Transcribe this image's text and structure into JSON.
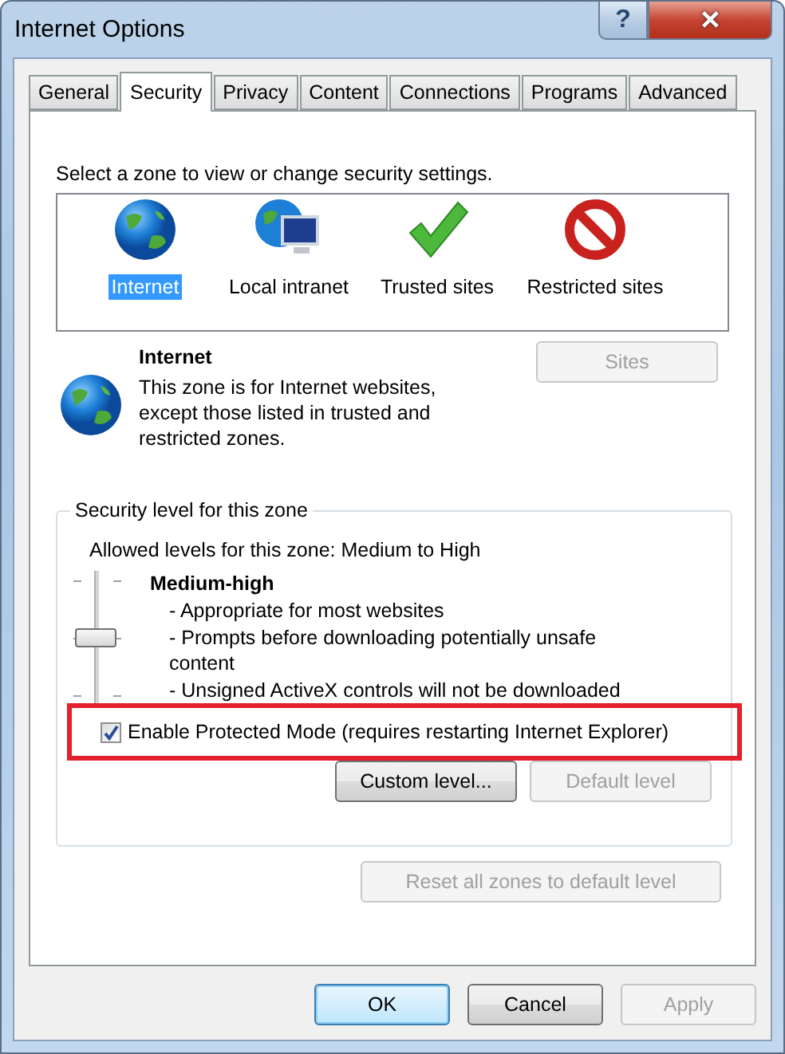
{
  "window": {
    "title": "Internet Options",
    "title_buttons": [
      "?",
      "✕"
    ]
  },
  "tabs": [
    {
      "label": "General",
      "selected": false
    },
    {
      "label": "Security",
      "selected": true
    },
    {
      "label": "Privacy",
      "selected": false
    },
    {
      "label": "Content",
      "selected": false
    },
    {
      "label": "Connections",
      "selected": false
    },
    {
      "label": "Programs",
      "selected": false
    },
    {
      "label": "Advanced",
      "selected": false
    }
  ],
  "zone_prompt": "Select a zone to view or change security settings.",
  "zones": [
    {
      "label": "Internet",
      "kind": "globe",
      "selected": true
    },
    {
      "label": "Local intranet",
      "kind": "intranet",
      "selected": false
    },
    {
      "label": "Trusted sites",
      "kind": "check",
      "selected": false
    },
    {
      "label": "Restricted sites",
      "kind": "blocked",
      "selected": false
    }
  ],
  "zone_info": {
    "title": "Internet",
    "description": "This zone is for Internet websites, except those listed in trusted and restricted zones.",
    "sites_button": {
      "label": "Sites",
      "disabled": true
    }
  },
  "security_level": {
    "legend": "Security level for this zone",
    "allowed": "Allowed levels for this zone: Medium to High",
    "level": 0.5,
    "level_name": "Medium-high",
    "details": [
      "- Appropriate for most websites",
      "- Prompts before downloading potentially unsafe content",
      "- Unsigned ActiveX controls will not be downloaded"
    ],
    "protected_mode": {
      "label": "Enable Protected Mode (requires restarting Internet Explorer)",
      "checked": true,
      "highlighted": true
    },
    "buttons": [
      {
        "label": "Custom level...",
        "disabled": false
      },
      {
        "label": "Default level",
        "disabled": true
      }
    ]
  },
  "reset_button": {
    "label": "Reset all zones to default level",
    "disabled": true
  },
  "dialog_buttons": [
    {
      "label": "OK",
      "disabled": false,
      "default": true
    },
    {
      "label": "Cancel",
      "disabled": false,
      "default": false
    },
    {
      "label": "Apply",
      "disabled": true,
      "default": false
    }
  ]
}
